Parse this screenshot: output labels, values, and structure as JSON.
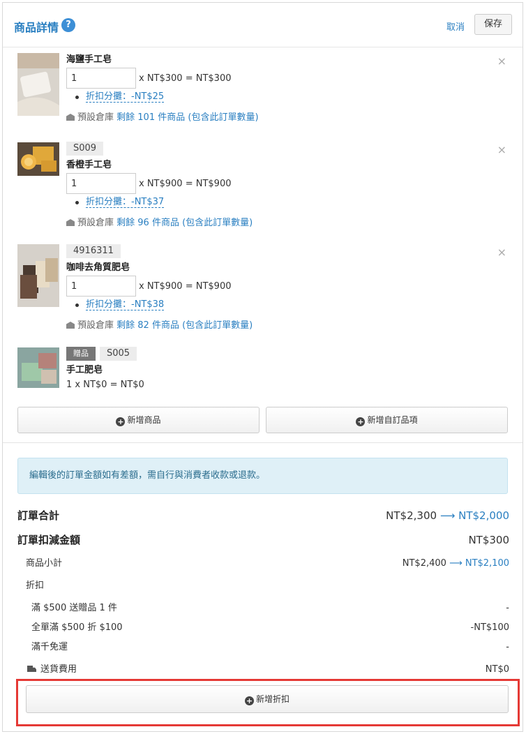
{
  "header": {
    "title": "商品詳情",
    "help_icon": "?",
    "cancel_label": "取消",
    "save_label": "保存"
  },
  "items": [
    {
      "name": "海鹽手工皂",
      "qty": "1",
      "calc": "x NT$300 = NT$300",
      "discount_label": "折扣分攤：",
      "discount_value": "-NT$25",
      "stock_prefix": "預設倉庫",
      "stock_text": "剩餘 101 件商品 (包含此訂單數量)",
      "remove_icon": "×"
    },
    {
      "sku": "S009",
      "name": "香橙手工皂",
      "qty": "1",
      "calc": "x NT$900 = NT$900",
      "discount_label": "折扣分攤：",
      "discount_value": "-NT$37",
      "stock_prefix": "預設倉庫",
      "stock_text": "剩餘 96 件商品 (包含此訂單數量)",
      "remove_icon": "×"
    },
    {
      "sku": "4916311",
      "name": "咖啡去角質肥皂",
      "qty": "1",
      "calc": "x NT$900 = NT$900",
      "discount_label": "折扣分攤：",
      "discount_value": "-NT$38",
      "stock_prefix": "預設倉庫",
      "stock_text": "剩餘 82 件商品 (包含此訂單數量)",
      "remove_icon": "×"
    }
  ],
  "gift": {
    "badge": "贈品",
    "sku": "S005",
    "name": "手工肥皂",
    "calc": "1 x NT$0 = NT$0"
  },
  "buttons": {
    "add_product": "新增商品",
    "add_custom": "新增自訂品項",
    "add_discount": "新增折扣",
    "plus_icon": "+"
  },
  "alert": "編輯後的訂單金額如有差額，需自行與消費者收款或退款。",
  "summary": {
    "order_total_label": "訂單合計",
    "order_total_old": "NT$2,300",
    "order_total_new": "NT$2,000",
    "deduct_label": "訂單扣減金額",
    "deduct_value": "NT$300",
    "subtotal_label": "商品小計",
    "subtotal_old": "NT$2,400",
    "subtotal_new": "NT$2,100",
    "discount_label": "折扣",
    "promo1_label": "滿 $500 送贈品 1 件",
    "promo1_value": "-",
    "promo2_label": "全單滿 $500 折 $100",
    "promo2_value": "-NT$100",
    "promo3_label": "滿千免運",
    "promo3_value": "-",
    "shipping_label": "送貨費用",
    "shipping_value": "NT$0",
    "arrow": "⟶"
  }
}
